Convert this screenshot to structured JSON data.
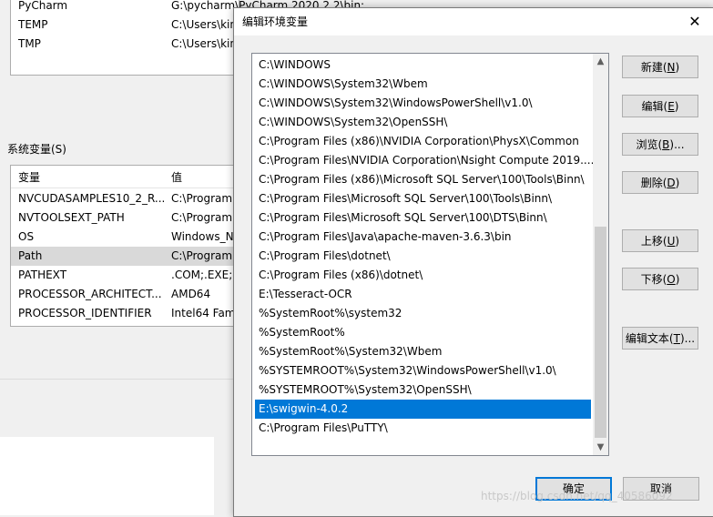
{
  "background": {
    "user_vars": [
      {
        "name": "PyCharm",
        "value": "G:\\pycharm\\PyCharm 2020.2.2\\bin;"
      },
      {
        "name": "TEMP",
        "value": "C:\\Users\\kin"
      },
      {
        "name": "TMP",
        "value": "C:\\Users\\kin"
      }
    ],
    "system_vars_label": "系统变量(S)",
    "col_name": "变量",
    "col_value": "值",
    "system_vars": [
      {
        "name": "NVCUDASAMPLES10_2_R...",
        "value": "C:\\Program"
      },
      {
        "name": "NVTOOLSEXT_PATH",
        "value": "C:\\Program"
      },
      {
        "name": "OS",
        "value": "Windows_N"
      },
      {
        "name": "Path",
        "value": "C:\\Program"
      },
      {
        "name": "PATHEXT",
        "value": ".COM;.EXE;."
      },
      {
        "name": "PROCESSOR_ARCHITECT...",
        "value": "AMD64"
      },
      {
        "name": "PROCESSOR_IDENTIFIER",
        "value": "Intel64 Fami"
      }
    ]
  },
  "dialog": {
    "title": "编辑环境变量",
    "close": "✕",
    "paths": [
      "C:\\WINDOWS",
      "C:\\WINDOWS\\System32\\Wbem",
      "C:\\WINDOWS\\System32\\WindowsPowerShell\\v1.0\\",
      "C:\\WINDOWS\\System32\\OpenSSH\\",
      "C:\\Program Files (x86)\\NVIDIA Corporation\\PhysX\\Common",
      "C:\\Program Files\\NVIDIA Corporation\\Nsight Compute 2019....",
      "C:\\Program Files (x86)\\Microsoft SQL Server\\100\\Tools\\Binn\\",
      "C:\\Program Files\\Microsoft SQL Server\\100\\Tools\\Binn\\",
      "C:\\Program Files\\Microsoft SQL Server\\100\\DTS\\Binn\\",
      "C:\\Program Files\\Java\\apache-maven-3.6.3\\bin",
      "C:\\Program Files\\dotnet\\",
      "C:\\Program Files (x86)\\dotnet\\",
      "E:\\Tesseract-OCR",
      "%SystemRoot%\\system32",
      "%SystemRoot%",
      "%SystemRoot%\\System32\\Wbem",
      "%SYSTEMROOT%\\System32\\WindowsPowerShell\\v1.0\\",
      "%SYSTEMROOT%\\System32\\OpenSSH\\",
      "E:\\swigwin-4.0.2",
      "C:\\Program Files\\PuTTY\\"
    ],
    "selected_index": 18,
    "buttons": {
      "new": {
        "text": "新建(",
        "key": "N",
        "end": ")"
      },
      "edit": {
        "text": "编辑(",
        "key": "E",
        "end": ")"
      },
      "browse": {
        "text": "浏览(",
        "key": "B",
        "end": ")..."
      },
      "delete": {
        "text": "删除(",
        "key": "D",
        "end": ")"
      },
      "up": {
        "text": "上移(",
        "key": "U",
        "end": ")"
      },
      "down": {
        "text": "下移(",
        "key": "O",
        "end": ")"
      },
      "edit_text": {
        "text": "编辑文本(",
        "key": "T",
        "end": ")..."
      },
      "ok": "确定",
      "cancel": "取消"
    }
  },
  "watermark": "https://blog.csdn.net/qq_40586092"
}
